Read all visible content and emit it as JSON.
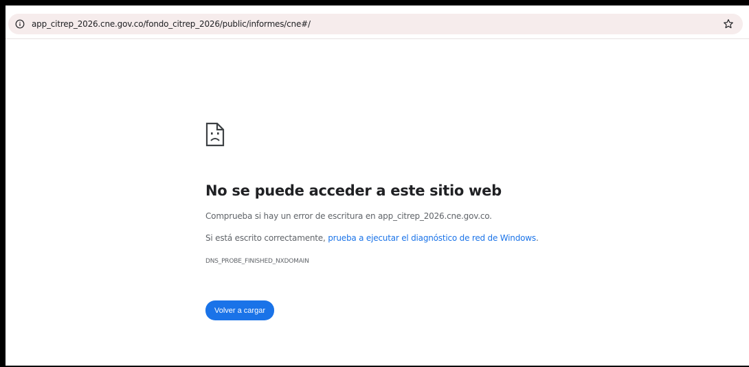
{
  "browser": {
    "url": "app_citrep_2026.cne.gov.co/fondo_citrep_2026/public/informes/cne#/",
    "icons": {
      "site_info": "info-icon",
      "bookmark": "star-icon"
    }
  },
  "error_page": {
    "icon": "sad-document-icon",
    "title": "No se puede acceder a este sitio web",
    "check_text": "Comprueba si hay un error de escritura en app_citrep_2026.cne.gov.co.",
    "correct_prefix": "Si está escrito correctamente, ",
    "diagnostic_link": "prueba a ejecutar el diagnóstico de red de Windows",
    "correct_suffix": ".",
    "error_code": "DNS_PROBE_FINISHED_NXDOMAIN",
    "reload_label": "Volver a cargar"
  },
  "colors": {
    "accent": "#1a73e8",
    "address_bar": "#f6ecec",
    "text_primary": "#202124",
    "text_secondary": "#5f6368"
  }
}
